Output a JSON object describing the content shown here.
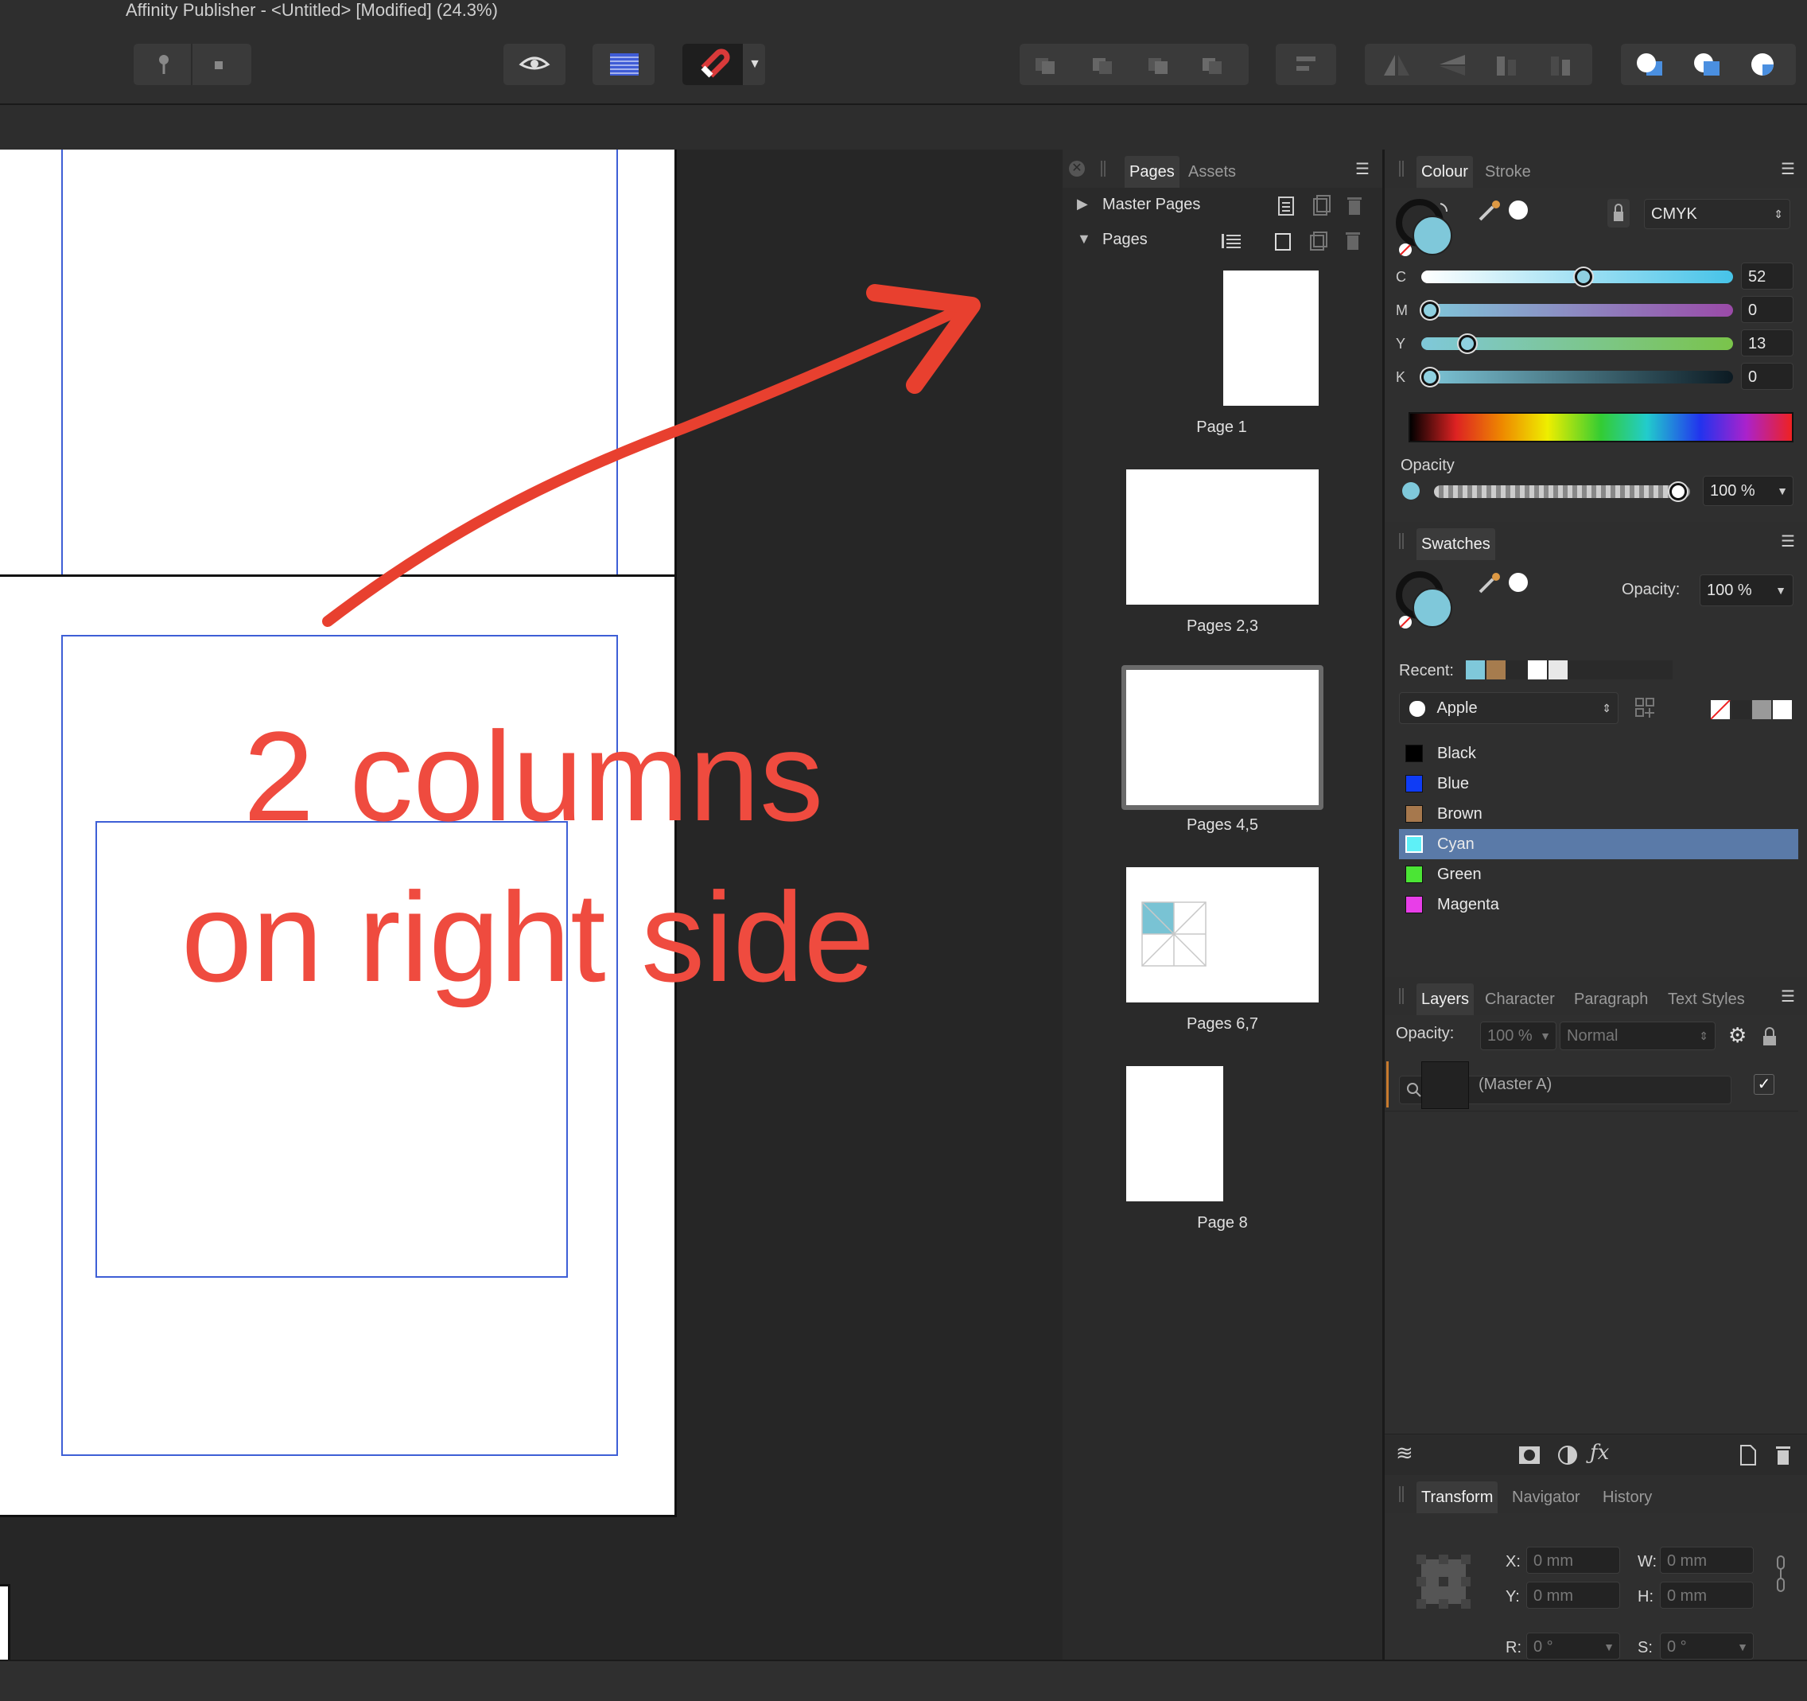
{
  "window": {
    "title": "Affinity Publisher - <Untitled> [Modified] (24.3%)"
  },
  "annotation": {
    "line1": "2 columns",
    "line2": "on right side"
  },
  "pages_panel": {
    "tabs": [
      "Pages",
      "Assets"
    ],
    "master_pages_label": "Master Pages",
    "pages_label": "Pages",
    "thumbnails": [
      "Page 1",
      "Pages 2,3",
      "Pages 4,5",
      "Pages 6,7",
      "Page 8"
    ],
    "selected": "Pages 4,5"
  },
  "colour_panel": {
    "tabs": [
      "Colour",
      "Stroke"
    ],
    "model": "CMYK",
    "channels": [
      {
        "label": "C",
        "value": "52",
        "fraction": 0.52
      },
      {
        "label": "M",
        "value": "0",
        "fraction": 0
      },
      {
        "label": "Y",
        "value": "13",
        "fraction": 0.13
      },
      {
        "label": "K",
        "value": "0",
        "fraction": 0
      }
    ],
    "opacity_label": "Opacity",
    "opacity_value": "100 %",
    "fill_color": "#7fc8da"
  },
  "swatches_panel": {
    "tab": "Swatches",
    "opacity_label": "Opacity:",
    "opacity_value": "100 %",
    "recent_label": "Recent:",
    "recent_colors": [
      "#7fc8da",
      "#a67c4e",
      "#2a2a2a",
      "#ffffff",
      "#e8e8e8"
    ],
    "palette": "Apple",
    "items": [
      {
        "name": "Black",
        "color": "#000000"
      },
      {
        "name": "Blue",
        "color": "#0f3cf5"
      },
      {
        "name": "Brown",
        "color": "#a6784d"
      },
      {
        "name": "Cyan",
        "color": "#5ef0f7"
      },
      {
        "name": "Green",
        "color": "#4be535"
      },
      {
        "name": "Magenta",
        "color": "#e83ee8"
      }
    ],
    "selected": "Cyan",
    "search_placeholder": ""
  },
  "layers_panel": {
    "tabs": [
      "Layers",
      "Character",
      "Paragraph",
      "Text Styles"
    ],
    "opacity_label": "Opacity:",
    "opacity_value": "100 %",
    "blend_mode": "Normal",
    "layers": [
      {
        "name": "(Master A)",
        "visible": true
      }
    ]
  },
  "transform_panel": {
    "tabs": [
      "Transform",
      "Navigator",
      "History"
    ],
    "x_label": "X:",
    "x_value": "0 mm",
    "y_label": "Y:",
    "y_value": "0 mm",
    "w_label": "W:",
    "w_value": "0 mm",
    "h_label": "H:",
    "h_value": "0 mm",
    "r_label": "R:",
    "r_value": "0 °",
    "s_label": "S:",
    "s_value": "0 °"
  }
}
